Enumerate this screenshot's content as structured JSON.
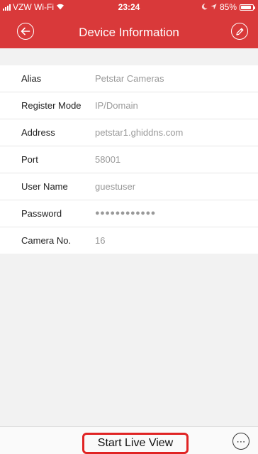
{
  "status_bar": {
    "carrier": "VZW Wi-Fi",
    "time": "23:24",
    "battery": "85%",
    "battery_level": 0.85
  },
  "nav": {
    "title": "Device Information",
    "back_icon": "back-arrow-icon",
    "edit_icon": "pencil-icon"
  },
  "fields": [
    {
      "label": "Alias",
      "value": "Petstar Cameras"
    },
    {
      "label": "Register Mode",
      "value": "IP/Domain"
    },
    {
      "label": "Address",
      "value": "petstar1.ghiddns.com"
    },
    {
      "label": "Port",
      "value": "58001"
    },
    {
      "label": "User Name",
      "value": "guestuser"
    },
    {
      "label": "Password",
      "value": "●●●●●●●●●●●●"
    },
    {
      "label": "Camera No.",
      "value": "16"
    }
  ],
  "bottom": {
    "live_view_label": "Start Live View",
    "more_icon": "ellipsis-icon"
  },
  "colors": {
    "header": "#d9393a",
    "highlight": "#e02424"
  }
}
